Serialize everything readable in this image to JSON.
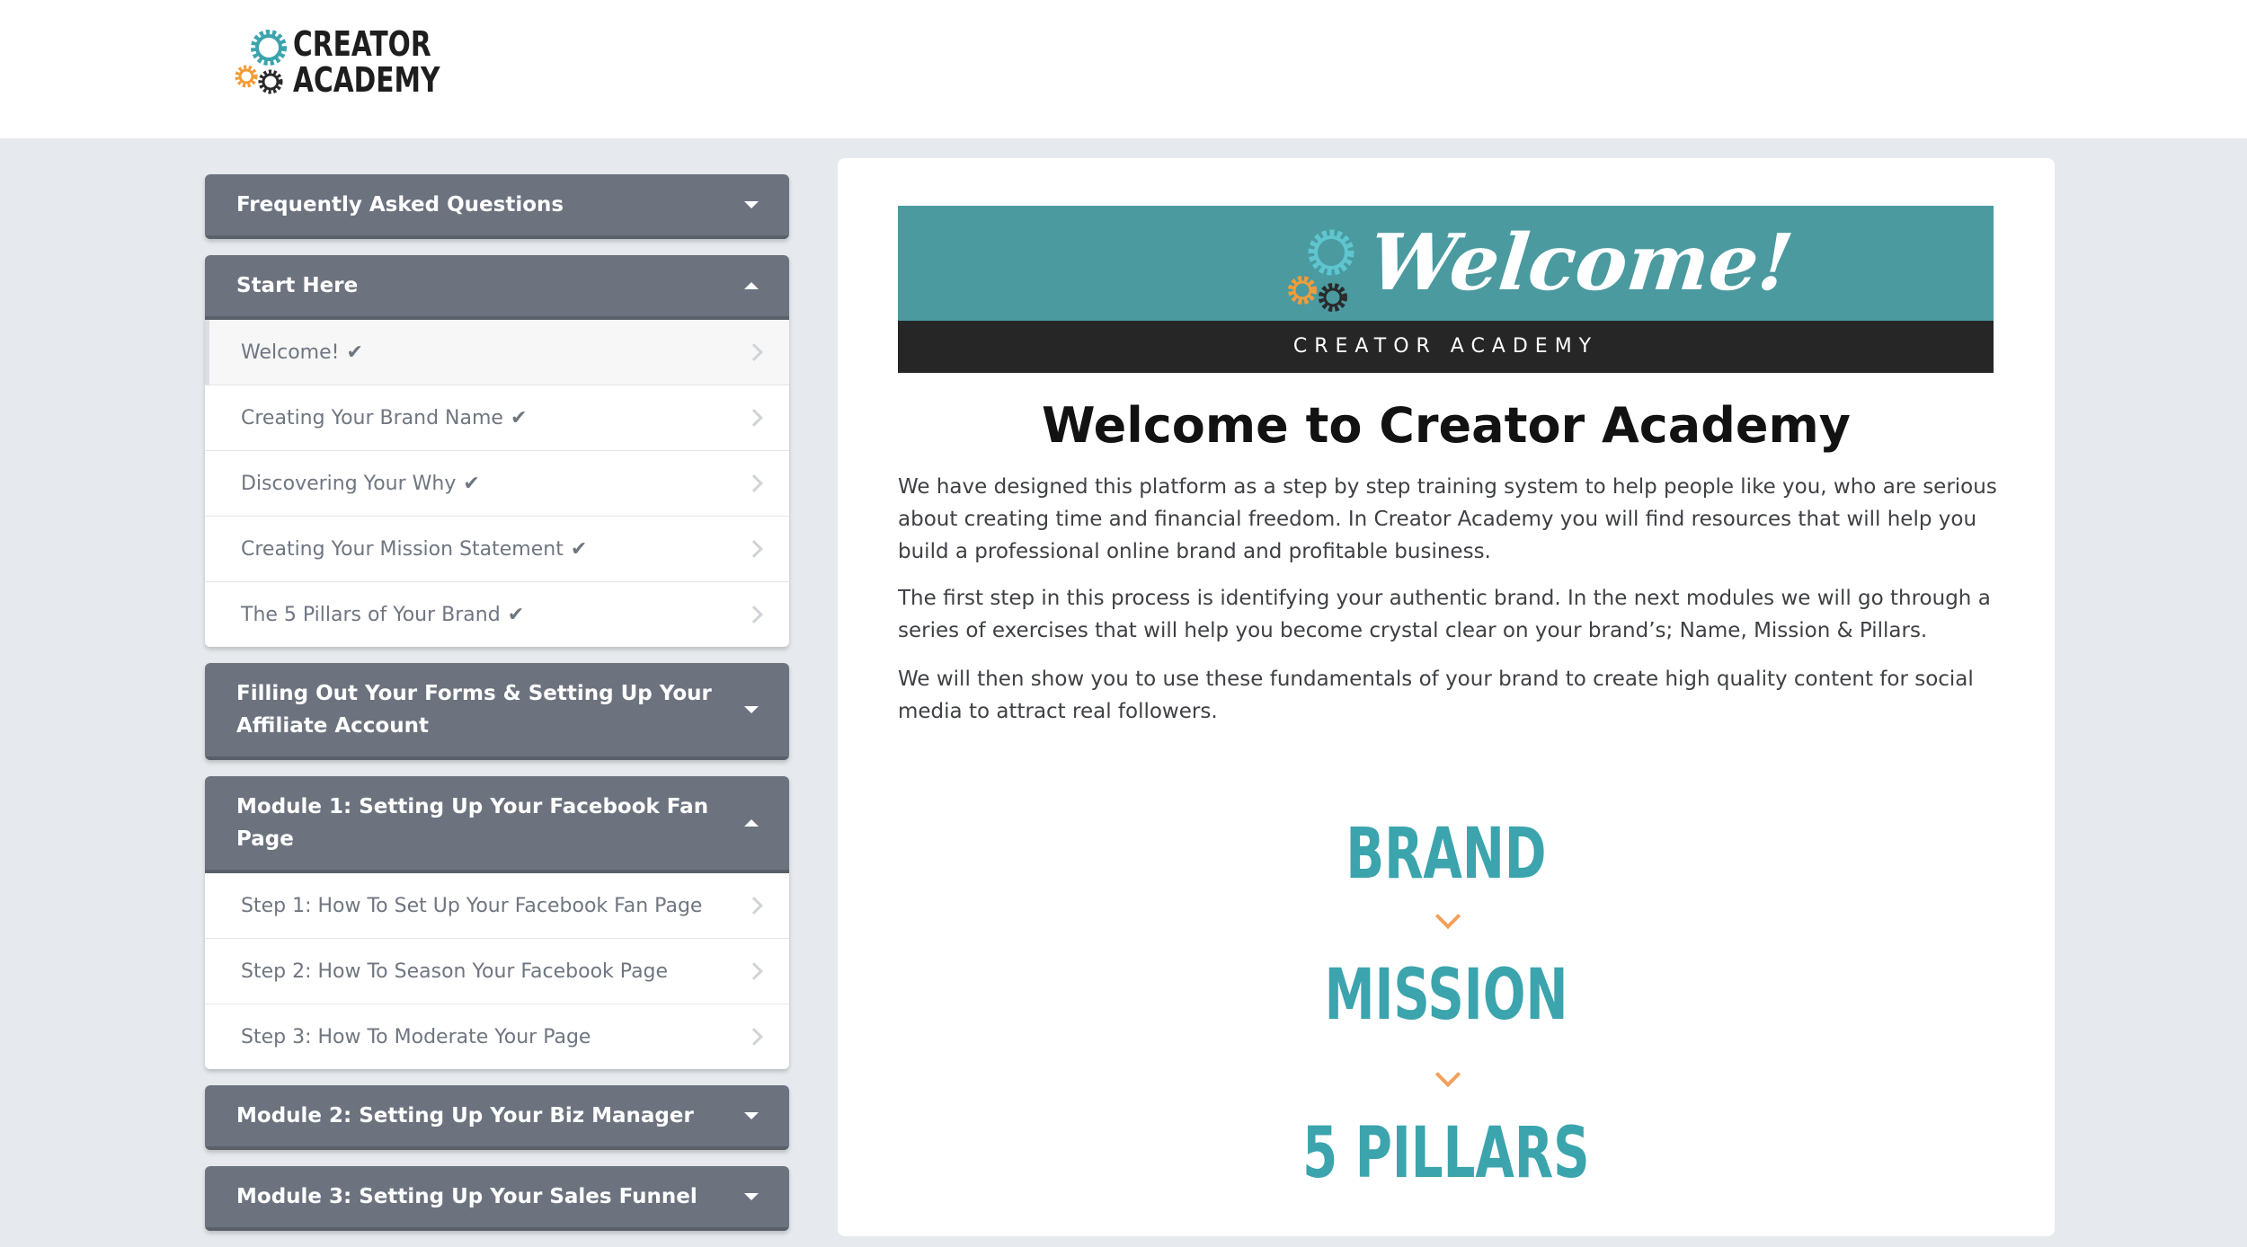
{
  "brand": {
    "logo_line1": "CREATOR",
    "logo_line2": "ACADEMY",
    "colors": {
      "teal": "#3ba4ad",
      "orange": "#f39c38",
      "dark": "#2a2a2a",
      "sidebar_header": "#6c737f"
    }
  },
  "sidebar": {
    "sections": [
      {
        "title": "Frequently Asked Questions",
        "expanded": false,
        "lessons": []
      },
      {
        "title": "Start Here",
        "expanded": true,
        "lessons": [
          {
            "label": "Welcome!",
            "completed": true,
            "active": true
          },
          {
            "label": "Creating Your Brand Name",
            "completed": true
          },
          {
            "label": "Discovering Your Why",
            "completed": true
          },
          {
            "label": "Creating Your Mission Statement",
            "completed": true
          },
          {
            "label": "The 5 Pillars of Your Brand",
            "completed": true
          }
        ]
      },
      {
        "title": "Filling Out Your Forms & Setting Up Your Affiliate Account",
        "expanded": false,
        "lessons": []
      },
      {
        "title": "Module 1: Setting Up Your Facebook Fan Page",
        "expanded": true,
        "lessons": [
          {
            "label": "Step 1: How To Set Up Your Facebook Fan Page",
            "completed": false
          },
          {
            "label": "Step 2: How To Season Your Facebook Page",
            "completed": false
          },
          {
            "label": "Step 3: How To Moderate Your Page",
            "completed": false
          }
        ]
      },
      {
        "title": "Module 2: Setting Up Your Biz Manager",
        "expanded": false,
        "lessons": []
      },
      {
        "title": "Module 3: Setting Up Your Sales Funnel",
        "expanded": false,
        "lessons": []
      }
    ]
  },
  "content": {
    "banner_title": "Welcome!",
    "banner_subtitle": "CREATOR ACADEMY",
    "title": "Welcome to Creator Academy",
    "paragraphs": [
      "We have designed this platform as a step by step training system to help people like you, who are serious about creating time and financial freedom.  In Creator Academy you will find resources that will help you build a professional online brand and profitable business.",
      "The first step in this process is identifying your authentic brand. In the next modules we will go through a series of exercises that will help you become crystal clear on your brand’s; Name, Mission & Pillars.",
      "We will then show you to use these fundamentals of your brand to create high quality content for social media to attract real followers."
    ],
    "flow": [
      "BRAND",
      "MISSION",
      "5 PILLARS"
    ]
  }
}
